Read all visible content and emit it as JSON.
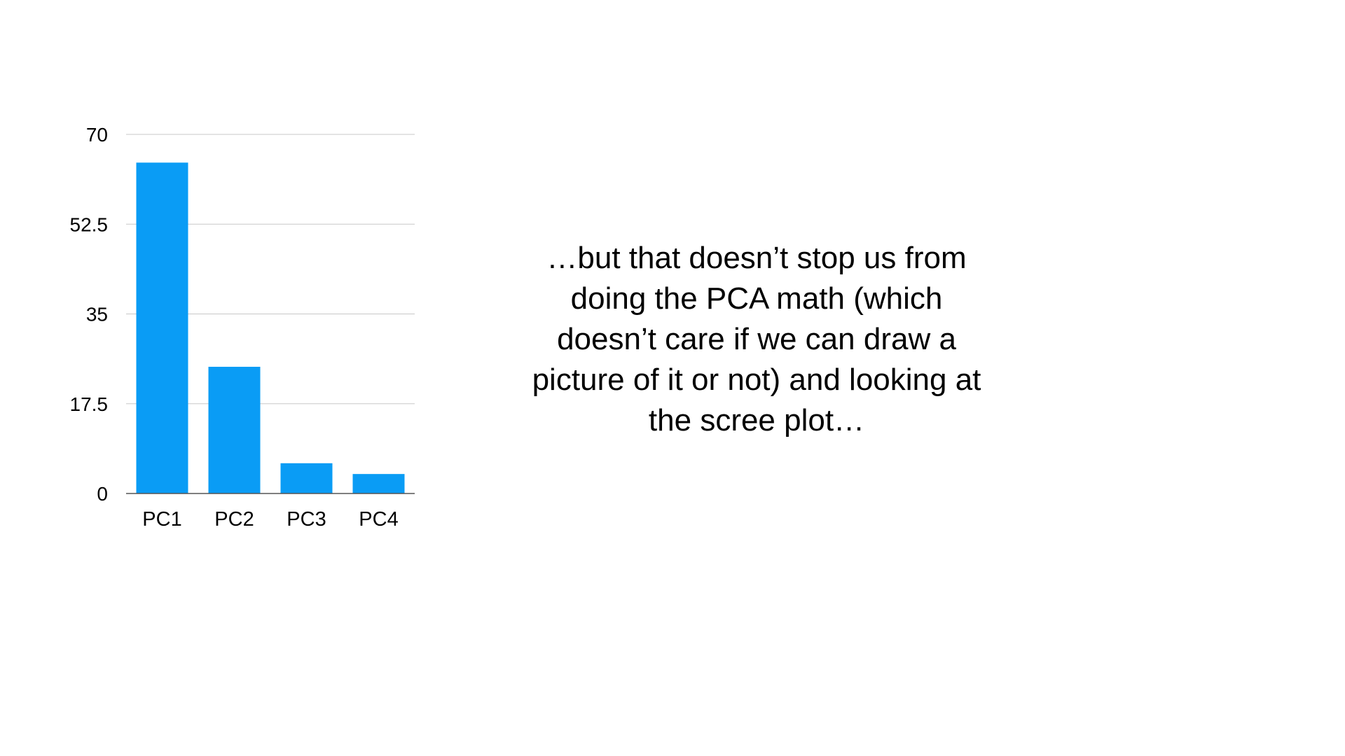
{
  "slide": {
    "text": "…but that doesn’t stop us from\ndoing the PCA math (which\ndoesn’t care if we can draw a\npicture of it or not) and looking at\nthe scree plot…"
  },
  "chart_data": {
    "type": "bar",
    "categories": [
      "PC1",
      "PC2",
      "PC3",
      "PC4"
    ],
    "values": [
      64.5,
      24.7,
      5.9,
      3.8
    ],
    "ylim": [
      0,
      70
    ],
    "yticks": [
      "0",
      "17.5",
      "35",
      "52.5",
      "70"
    ],
    "title": "",
    "xlabel": "",
    "ylabel": "",
    "grid": true,
    "legend": "none",
    "colors": {
      "bar": "#0A9CF5",
      "grid": "#C8C8C8",
      "axis": "#555555"
    }
  }
}
